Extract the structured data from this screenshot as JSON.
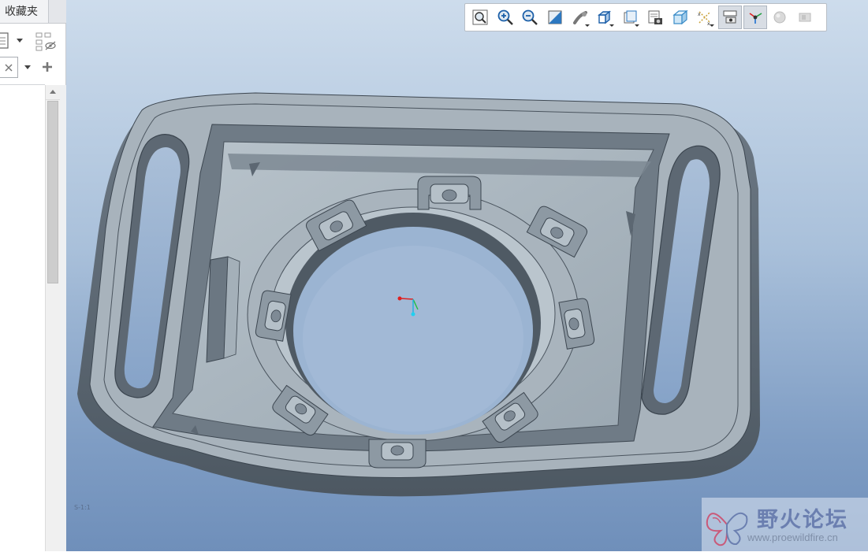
{
  "left_panel": {
    "tab_label": "收藏夹",
    "icons": [
      "document-icon",
      "dropdown-arrow-icon",
      "show-hide-icon",
      "clear-icon",
      "dropdown-arrow-icon",
      "add-icon"
    ]
  },
  "toolbar": {
    "buttons": [
      {
        "name": "zoom-refit",
        "icon": "zoom-refit-icon"
      },
      {
        "name": "zoom-in",
        "icon": "zoom-in-icon"
      },
      {
        "name": "zoom-out",
        "icon": "zoom-out-icon"
      },
      {
        "name": "repaint",
        "icon": "repaint-icon"
      },
      {
        "name": "spin-center",
        "icon": "spin-center-icon"
      },
      {
        "name": "display-style",
        "icon": "display-style-icon"
      },
      {
        "name": "saved-orientations",
        "icon": "saved-orientations-icon"
      },
      {
        "name": "view-manager",
        "icon": "view-manager-icon"
      },
      {
        "name": "perspective",
        "icon": "perspective-icon"
      },
      {
        "name": "datum-display",
        "icon": "datum-display-icon"
      },
      {
        "name": "annotation-display",
        "icon": "annotation-display-icon",
        "active": true
      },
      {
        "name": "spin-center-display",
        "icon": "spin-center-display-icon",
        "active": true
      },
      {
        "name": "appearance",
        "icon": "appearance-sphere-icon",
        "disabled": true
      },
      {
        "name": "layers",
        "icon": "layers-icon",
        "disabled": true
      }
    ]
  },
  "viewport": {
    "view_label": "S-1:1"
  },
  "watermark": {
    "title": "野火论坛",
    "url": "www.proewildfire.cn"
  },
  "colors": {
    "background_top": "#cddcec",
    "background_bottom": "#6f8fba",
    "model_gray": "#9aa5ae",
    "toolbar_bg": "#ffffff"
  }
}
